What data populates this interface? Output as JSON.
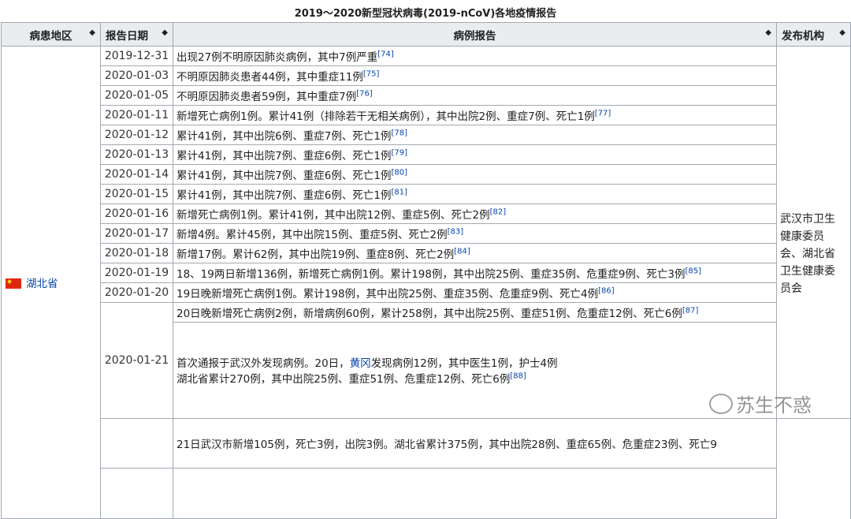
{
  "caption": "2019～2020新型冠状病毒(2019-nCoV)各地疫情报告",
  "headers": {
    "region": "病患地区",
    "date": "报告日期",
    "report": "病例报告",
    "org": "发布机构"
  },
  "sort_icon": "◆",
  "region": {
    "flag_icon": "china-flag-icon",
    "name": "湖北省"
  },
  "org_1": {
    "lines": [
      "武汉市卫生",
      "健康委员",
      "会、湖北省",
      "卫生健康委",
      "员会"
    ]
  },
  "org_2": {
    "lines": [
      "湖北省卫生",
      "健康委员会"
    ]
  },
  "rows": [
    {
      "date": "2019-12-31",
      "text": "出现27例不明原因肺炎病例，其中7例严重",
      "ref": "[74]"
    },
    {
      "date": "2020-01-03",
      "text": "不明原因肺炎患者44例，其中重症11例",
      "ref": "[75]"
    },
    {
      "date": "2020-01-05",
      "text": "不明原因肺炎患者59例，其中重症7例",
      "ref": "[76]"
    },
    {
      "date": "2020-01-11",
      "text": "新增死亡病例1例。累计41例（排除若干无相关病例），其中出院2例、重症7例、死亡1例",
      "ref": "[77]"
    },
    {
      "date": "2020-01-12",
      "text": "累计41例，其中出院6例、重症7例、死亡1例",
      "ref": "[78]"
    },
    {
      "date": "2020-01-13",
      "text": "累计41例，其中出院7例、重症6例、死亡1例",
      "ref": "[79]"
    },
    {
      "date": "2020-01-14",
      "text": "累计41例，其中出院7例、重症6例、死亡1例",
      "ref": "[80]"
    },
    {
      "date": "2020-01-15",
      "text": "累计41例，其中出院7例、重症6例、死亡1例",
      "ref": "[81]"
    },
    {
      "date": "2020-01-16",
      "text": "新增死亡病例1例。累计41例，其中出院12例、重症5例、死亡2例",
      "ref": "[82]"
    },
    {
      "date": "2020-01-17",
      "text": "新增4例。累计45例，其中出院15例、重症5例、死亡2例",
      "ref": "[83]"
    },
    {
      "date": "2020-01-18",
      "text": "新增17例。累计62例，其中出院19例、重症8例、死亡2例",
      "ref": "[84]"
    },
    {
      "date": "2020-01-19",
      "text": "18、19两日新增136例，新增死亡病例1例。累计198例，其中出院25例、重症35例、危重症9例、死亡3例",
      "ref": "[85]"
    },
    {
      "date": "2020-01-20",
      "text": "19日晚新增死亡病例1例。累计198例，其中出院25例、重症35例、危重症9例、死亡4例",
      "ref": "[86]"
    }
  ],
  "row_21": {
    "date": "2020-01-21",
    "a_text": "20日晚新增死亡病例2例，新增病例60例，累计258例，其中出院25例、重症51例、危重症12例、死亡6例",
    "a_ref": "[87]",
    "b_line1_pre": "首次通报于武汉外发现病例。20日，",
    "b_link": "黄冈",
    "b_line1_post": "发现病例12例，其中医生1例，护士4例",
    "b_line2": "湖北省累计270例，其中出院25例、重症51例、危重症12例、死亡6例",
    "b_ref": "[88]"
  },
  "row_22": {
    "text": "21日武汉市新增105例，死亡3例，出院3例。湖北省累计375例，其中出院28例、重症65例、危重症23例、死亡9"
  },
  "watermark": {
    "icon": "wechat-icon",
    "text": "苏生不惑"
  }
}
